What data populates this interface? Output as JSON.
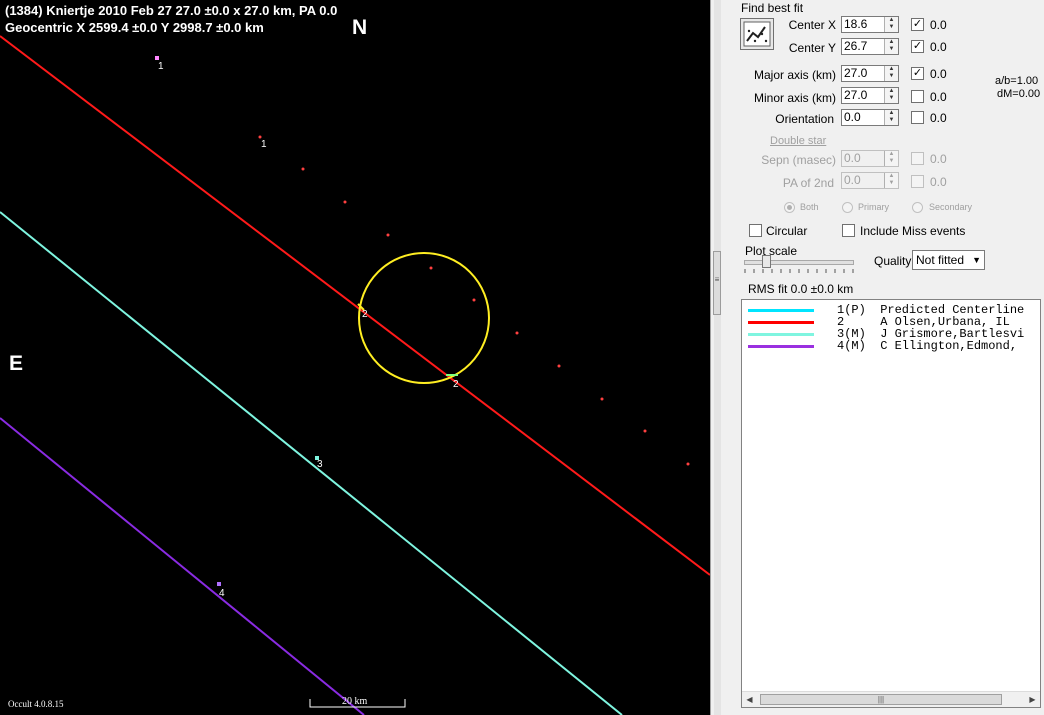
{
  "plot": {
    "title_line1": "(1384) Kniertje  2010 Feb 27   27.0 ±0.0 x 27.0 km,  PA 0.0",
    "title_line2": "Geocentric  X  2599.4 ±0.0   Y 2998.7 ±0.0 km",
    "north_label": "N",
    "east_label": "E",
    "version": "Occult 4.0.8.15",
    "scale_label": "20 km",
    "chord_labels": [
      "1",
      "1",
      "2",
      "2",
      "3",
      "4"
    ],
    "colors": {
      "background": "#000000",
      "ellipse": "#ffee22",
      "chord_olsen": "#ff1a1a",
      "chord_grismore": "#7ff5e0",
      "chord_ellington": "#8a2be2",
      "predicted_dots": "#ff4040",
      "station_marker": "#ff88ff"
    }
  },
  "panel": {
    "find_best_fit": "Find best fit",
    "center_x": {
      "label": "Center X",
      "value": "18.6",
      "checked": true,
      "uncert": "0.0"
    },
    "center_y": {
      "label": "Center Y",
      "value": "26.7",
      "checked": true,
      "uncert": "0.0"
    },
    "major_axis": {
      "label": "Major axis (km)",
      "value": "27.0",
      "checked": true,
      "uncert": "0.0"
    },
    "minor_axis": {
      "label": "Minor axis (km)",
      "value": "27.0",
      "checked": false,
      "uncert": "0.0"
    },
    "orientation": {
      "label": "Orientation",
      "value": "0.0",
      "checked": false,
      "uncert": "0.0"
    },
    "ratio_ab": "a/b=1.00",
    "delta_mag": "dM=0.00",
    "double_star": "Double star",
    "sepn": {
      "label": "Sepn (masec)",
      "value": "0.0",
      "uncert": "0.0"
    },
    "pa_2nd": {
      "label": "PA of 2nd",
      "value": "0.0",
      "uncert": "0.0"
    },
    "radio_both": "Both",
    "radio_primary": "Primary",
    "radio_secondary": "Secondary",
    "circular": "Circular",
    "include_miss": "Include Miss events",
    "plot_scale": "Plot scale",
    "quality_label": "Quality",
    "quality_value": "Not fitted",
    "rms_fit": "RMS fit 0.0 ±0.0 km"
  },
  "legend": [
    {
      "text": "1(P)  Predicted Centerline",
      "color": "#00e5ff"
    },
    {
      "text": "2     A Olsen,Urbana, IL",
      "color": "#ff0000"
    },
    {
      "text": "3(M)  J Grismore,Bartlesvi",
      "color": "#7ff5e0"
    },
    {
      "text": "4(M)  C Ellington,Edmond,",
      "color": "#9a30e0"
    }
  ]
}
